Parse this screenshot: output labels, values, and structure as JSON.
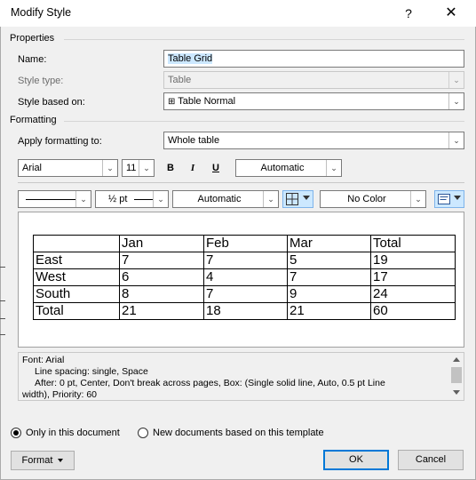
{
  "window": {
    "title": "Modify Style",
    "help": "?",
    "close": "✕"
  },
  "properties": {
    "section": "Properties",
    "name_label": "Name:",
    "name_value": "Table Grid",
    "style_type_label": "Style type:",
    "style_type_value": "Table",
    "based_on_label": "Style based on:",
    "based_on_value": "Table Normal"
  },
  "formatting": {
    "section": "Formatting",
    "apply_label": "Apply formatting to:",
    "apply_value": "Whole table",
    "font": "Arial",
    "size": "11",
    "bold": "B",
    "italic": "I",
    "underline": "U",
    "color": "Automatic",
    "line_weight": "½ pt",
    "border_color": "Automatic",
    "fill": "No Color"
  },
  "preview": {
    "rows": [
      [
        "",
        "Jan",
        "Feb",
        "Mar",
        "Total"
      ],
      [
        "East",
        "7",
        "7",
        "5",
        "19"
      ],
      [
        "West",
        "6",
        "4",
        "7",
        "17"
      ],
      [
        "South",
        "8",
        "7",
        "9",
        "24"
      ],
      [
        "Total",
        "21",
        "18",
        "21",
        "60"
      ]
    ]
  },
  "description": {
    "line1": "Font: Arial",
    "line2": "Line spacing:  single, Space",
    "line3": "After:  0 pt, Center, Don't break across pages, Box: (Single solid line, Auto,  0.5 pt Line",
    "line4": "width), Priority: 60"
  },
  "options": {
    "only_doc": "Only in this document",
    "new_docs": "New documents based on this template"
  },
  "buttons": {
    "format": "Format",
    "ok": "OK",
    "cancel": "Cancel"
  }
}
